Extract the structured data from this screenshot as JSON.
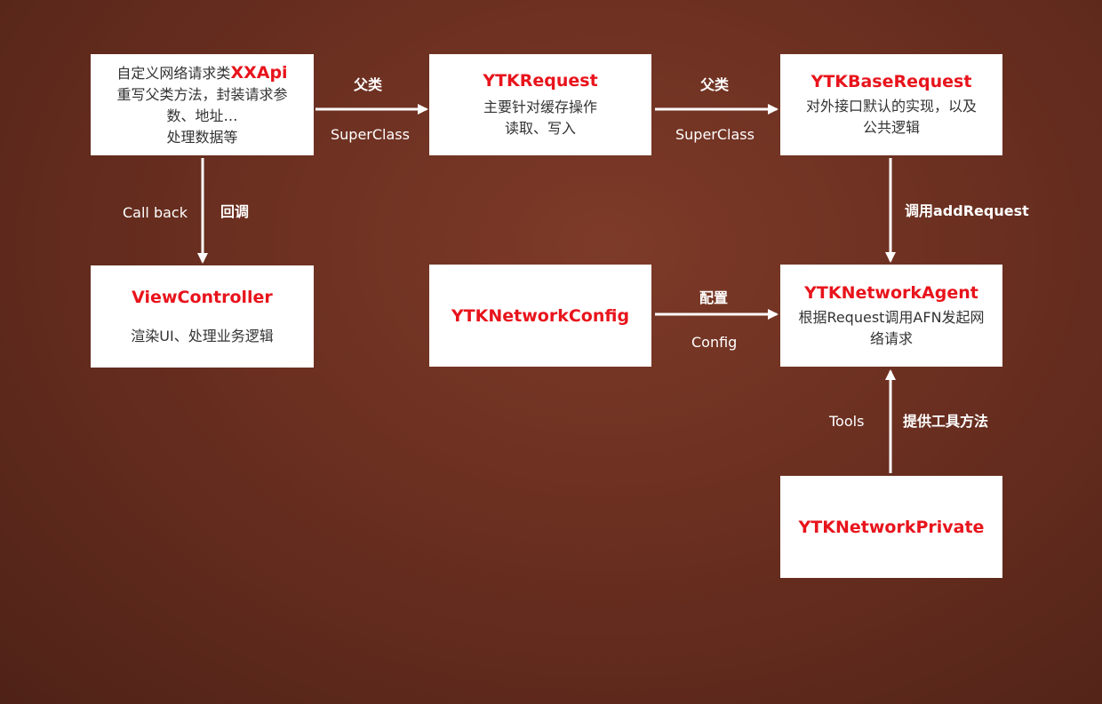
{
  "boxes": {
    "xxapi": {
      "line1_prefix": "自定义网络请求类",
      "line1_accent": "XXApi",
      "line2": "重写父类方法，封装请求参",
      "line3": "数、地址…",
      "line4": "处理数据等"
    },
    "ytkrequest": {
      "title": "YTKRequest",
      "line1": "主要针对缓存操作",
      "line2": "读取、写入"
    },
    "ytkbaserequest": {
      "title": "YTKBaseRequest",
      "line1": "对外接口默认的实现，以及",
      "line2": "公共逻辑"
    },
    "viewcontroller": {
      "title": "ViewController",
      "line1": "渲染UI、处理业务逻辑"
    },
    "ytknetworkconfig": {
      "title": "YTKNetworkConfig"
    },
    "ytknetworkagent": {
      "title": "YTKNetworkAgent",
      "line1": "根据Request调用AFN发起网",
      "line2": "络请求"
    },
    "ytknetworkprivate": {
      "title": "YTKNetworkPrivate"
    }
  },
  "edges": {
    "xxapi_to_request": {
      "label_top": "父类",
      "label_bottom": "SuperClass"
    },
    "request_to_base": {
      "label_top": "父类",
      "label_bottom": "SuperClass"
    },
    "xxapi_to_vc": {
      "label_left": "Call back",
      "label_right": "回调"
    },
    "base_to_agent": {
      "label": "调用addRequest"
    },
    "config_to_agent": {
      "label_top": "配置",
      "label_bottom": "Config"
    },
    "private_to_agent": {
      "label_left": "Tools",
      "label_right": "提供工具方法"
    }
  },
  "colors": {
    "accent": "#e8141c",
    "background": "#6a2f20",
    "box": "#ffffff",
    "line": "#ffffff"
  }
}
